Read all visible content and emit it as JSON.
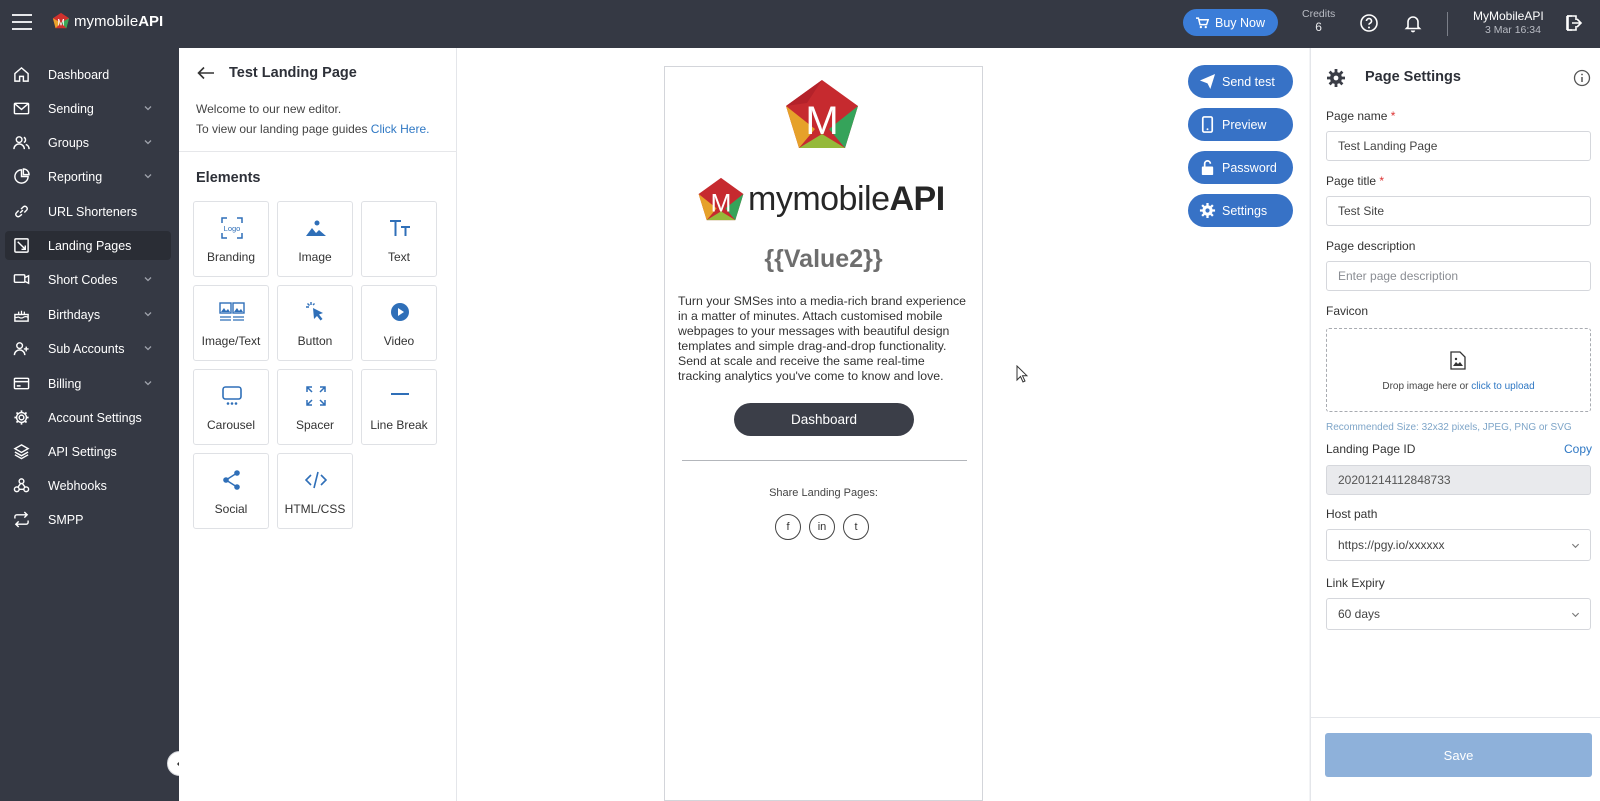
{
  "app": {
    "brand": "mymobileAPI",
    "brand_plain": "mymobile",
    "brand_bold": "API",
    "logo_letter": "M"
  },
  "topbar": {
    "buy_label": "Buy Now",
    "credits_label": "Credits",
    "credits_value": "6",
    "account_name": "MyMobileAPI",
    "account_date": "3 Mar 16:34"
  },
  "sidebar": {
    "items": [
      {
        "label": "Dashboard",
        "icon": "home-icon",
        "chevron": false
      },
      {
        "label": "Sending",
        "icon": "mail-icon",
        "chevron": true
      },
      {
        "label": "Groups",
        "icon": "users-icon",
        "chevron": true
      },
      {
        "label": "Reporting",
        "icon": "pie-chart-icon",
        "chevron": true
      },
      {
        "label": "URL Shorteners",
        "icon": "link-icon",
        "chevron": false
      },
      {
        "label": "Landing Pages",
        "icon": "landing-page-icon",
        "chevron": false,
        "active": true
      },
      {
        "label": "Short Codes",
        "icon": "short-code-icon",
        "chevron": true
      },
      {
        "label": "Birthdays",
        "icon": "cake-icon",
        "chevron": true
      },
      {
        "label": "Sub Accounts",
        "icon": "user-plus-icon",
        "chevron": true
      },
      {
        "label": "Billing",
        "icon": "credit-card-icon",
        "chevron": true
      },
      {
        "label": "Account Settings",
        "icon": "gear-icon",
        "chevron": false
      },
      {
        "label": "API Settings",
        "icon": "layers-icon",
        "chevron": false
      },
      {
        "label": "Webhooks",
        "icon": "webhook-icon",
        "chevron": false
      },
      {
        "label": "SMPP",
        "icon": "repeat-icon",
        "chevron": false
      }
    ]
  },
  "editor": {
    "title": "Test Landing Page",
    "welcome_line1": "Welcome to our new editor.",
    "welcome_line2": "To view our landing page guides ",
    "welcome_link": "Click Here.",
    "elements_heading": "Elements",
    "elements": [
      {
        "label": "Branding",
        "icon": "logo-icon"
      },
      {
        "label": "Image",
        "icon": "image-icon"
      },
      {
        "label": "Text",
        "icon": "text-icon"
      },
      {
        "label": "Image/Text",
        "icon": "image-text-icon"
      },
      {
        "label": "Button",
        "icon": "pointer-click-icon"
      },
      {
        "label": "Video",
        "icon": "play-icon"
      },
      {
        "label": "Carousel",
        "icon": "carousel-icon"
      },
      {
        "label": "Spacer",
        "icon": "expand-icon"
      },
      {
        "label": "Line Break",
        "icon": "line-icon"
      },
      {
        "label": "Social",
        "icon": "share-icon"
      },
      {
        "label": "HTML/CSS",
        "icon": "code-icon"
      }
    ],
    "branding_icon_text": "Logo"
  },
  "preview": {
    "heading": "{{Value2}}",
    "body": "Turn your SMSes into a media-rich brand experience in a matter of minutes. Attach customised mobile webpages to your messages with beautiful design templates and simple drag-and-drop functionality. Send at scale and receive the same real-time tracking analytics you've come to know and love.",
    "button_label": "Dashboard",
    "share_label": "Share Landing Pages:",
    "social": [
      "f",
      "in",
      "t"
    ]
  },
  "actions": {
    "send_test": "Send test",
    "preview": "Preview",
    "password": "Password",
    "settings": "Settings"
  },
  "settings": {
    "title": "Page Settings",
    "page_name_label": "Page name",
    "page_name_value": "Test Landing Page",
    "page_title_label": "Page title",
    "page_title_value": "Test Site",
    "page_desc_label": "Page description",
    "page_desc_placeholder": "Enter page description",
    "favicon_label": "Favicon",
    "drop_text": "Drop image here or ",
    "drop_link": "click to upload",
    "hint": "Recommended Size: 32x32 pixels, JPEG, PNG or SVG",
    "landing_id_label": "Landing Page ID",
    "copy_label": "Copy",
    "landing_id_value": "20201214112848733",
    "host_label": "Host path",
    "host_value": "https://pgy.io/xxxxxx",
    "expiry_label": "Link Expiry",
    "expiry_value": "60 days",
    "required_mark": "*",
    "save_label": "Save"
  },
  "colors": {
    "topbar": "#353944",
    "accent": "#3772c6",
    "save_disabled": "#8eb1da"
  }
}
